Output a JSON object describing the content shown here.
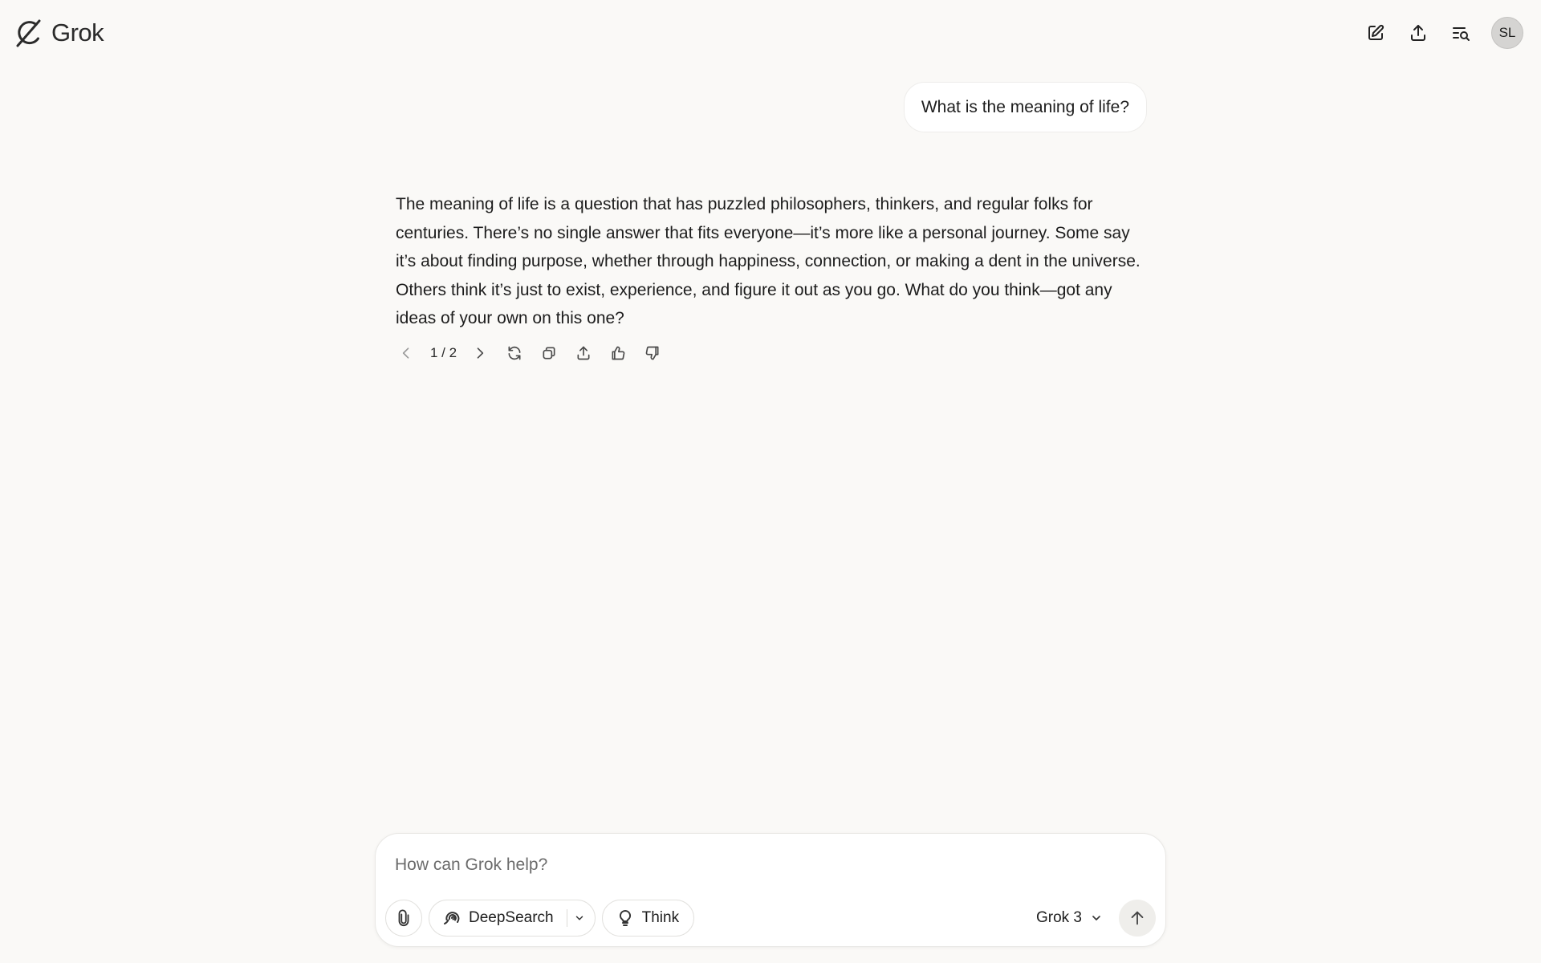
{
  "header": {
    "brand": "Grok",
    "avatar_initials": "SL",
    "actions": [
      "new-chat-icon",
      "share-icon",
      "search-history-icon"
    ]
  },
  "conversation": {
    "user_message": "What is the meaning of life?",
    "assistant_message": "The meaning of life is a question that has puzzled philosophers, thinkers, and regular folks for centuries. There’s no single answer that fits everyone—it’s more like a personal journey. Some say it’s about finding purpose, whether through happiness, connection, or making a dent in the universe. Others think it’s just to exist, experience, and figure it out as you go. What do you think—got any ideas of your own on this one?",
    "pager": "1 / 2",
    "message_actions": [
      "chevron-left-icon",
      "chevron-right-icon",
      "regenerate-icon",
      "copy-icon",
      "share-icon",
      "thumbs-up-icon",
      "thumbs-down-icon"
    ]
  },
  "composer": {
    "placeholder": "How can Grok help?",
    "value": "",
    "deepsearch_label": "DeepSearch",
    "think_label": "Think",
    "model_label": "Grok 3"
  },
  "colors": {
    "background": "#faf9f7",
    "surface": "#ffffff",
    "avatar_bg": "#d5d4d2",
    "send_bg": "#efeeeb"
  }
}
